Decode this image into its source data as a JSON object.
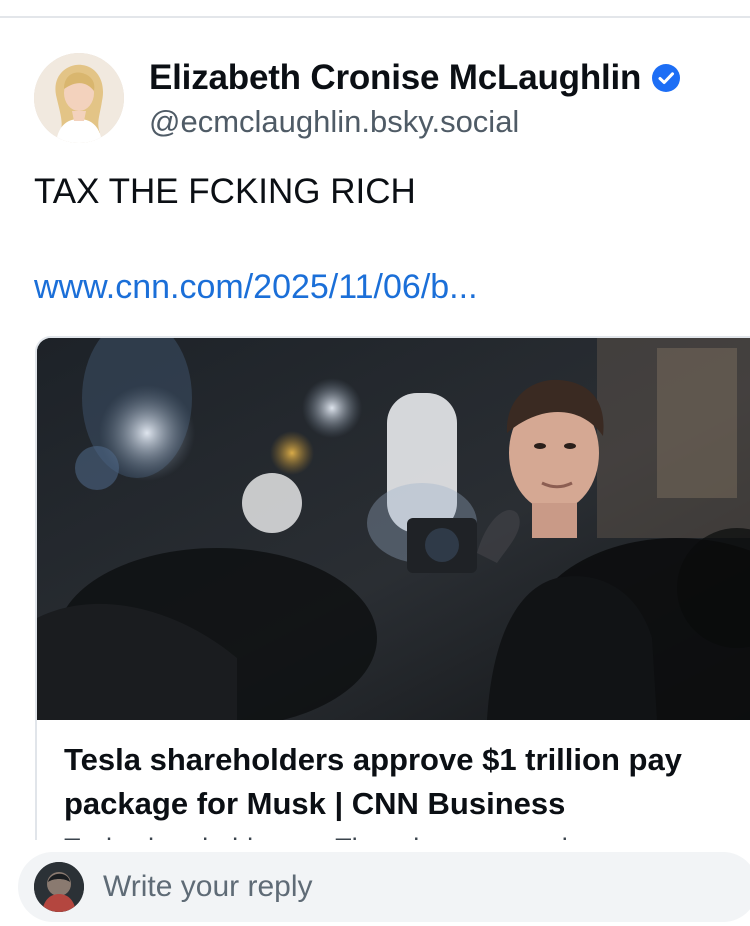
{
  "post": {
    "author": {
      "name": "Elizabeth Cronise McLaughlin",
      "handle": "@ecmclaughlin.bsky.social",
      "verified": true,
      "avatar_icon": "avatar-blonde-woman",
      "verified_icon": "verified-check-icon"
    },
    "text": "TAX THE FCKING RICH",
    "link_text": "www.cnn.com/2025/11/06/b..."
  },
  "link_card": {
    "image_icon": "press-photo-musk",
    "title": "Tesla shareholders approve $1 trillion pay package for Musk | CNN Business",
    "description": "Tesla shareholders on Thursday approved a"
  },
  "reply_bar": {
    "placeholder": "Write your reply",
    "avatar_icon": "user-avatar"
  },
  "colors": {
    "link": "#1b6fd8",
    "verified": "#1d6ef5",
    "text": "#0b0f14",
    "muted": "#4f5b66"
  }
}
